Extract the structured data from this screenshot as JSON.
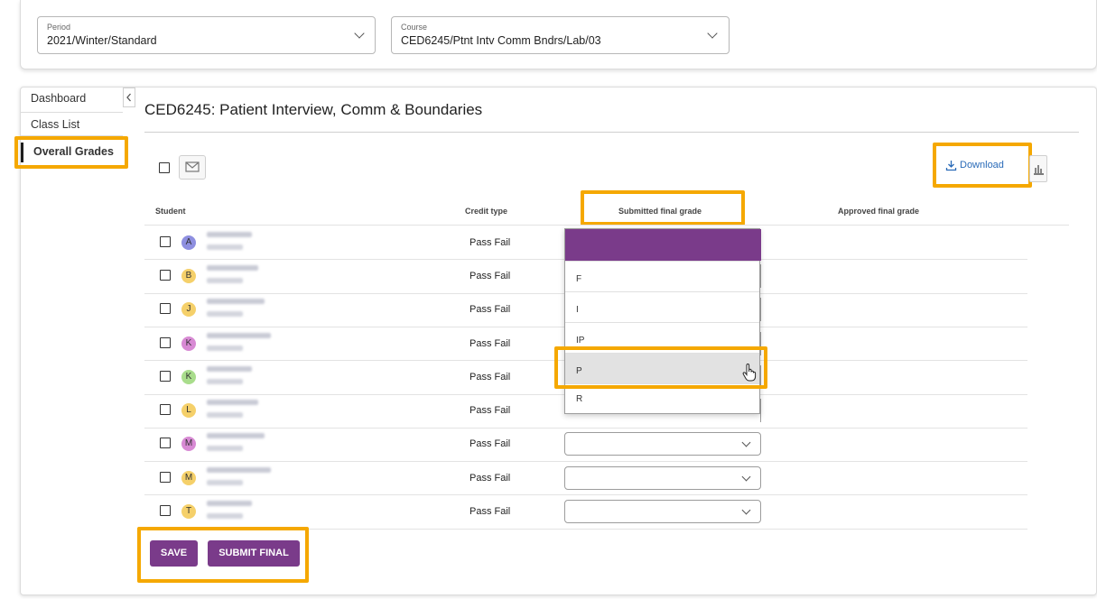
{
  "selectors": {
    "period": {
      "label": "Period",
      "value": "2021/Winter/Standard"
    },
    "course": {
      "label": "Course",
      "value": "CED6245/Ptnt Intv Comm Bndrs/Lab/03"
    }
  },
  "sidebar": {
    "items": [
      {
        "label": "Dashboard"
      },
      {
        "label": "Class List"
      },
      {
        "label": "Overall Grades",
        "active": true
      }
    ]
  },
  "page": {
    "title": "CED6245: Patient Interview, Comm & Boundaries"
  },
  "toolbar": {
    "download_label": "Download"
  },
  "table": {
    "headers": {
      "student": "Student",
      "credit_type": "Credit type",
      "submitted": "Submitted final grade",
      "approved": "Approved final grade"
    },
    "rows": [
      {
        "initial": "A",
        "avatar_color": "#8e8fe0",
        "credit_type": "Pass Fail"
      },
      {
        "initial": "B",
        "avatar_color": "#f5d06a",
        "credit_type": "Pass Fail"
      },
      {
        "initial": "J",
        "avatar_color": "#f5d06a",
        "credit_type": "Pass Fail"
      },
      {
        "initial": "K",
        "avatar_color": "#d88ad4",
        "credit_type": "Pass Fail"
      },
      {
        "initial": "K",
        "avatar_color": "#a9dd8c",
        "credit_type": "Pass Fail"
      },
      {
        "initial": "L",
        "avatar_color": "#f5d06a",
        "credit_type": "Pass Fail"
      },
      {
        "initial": "M",
        "avatar_color": "#d88ad4",
        "credit_type": "Pass Fail"
      },
      {
        "initial": "M",
        "avatar_color": "#f5d06a",
        "credit_type": "Pass Fail"
      },
      {
        "initial": "T",
        "avatar_color": "#f5d06a",
        "credit_type": "Pass Fail"
      }
    ]
  },
  "grade_dropdown": {
    "options": [
      "",
      "F",
      "I",
      "IP",
      "P",
      "R"
    ],
    "hovered": "P"
  },
  "actions": {
    "save_label": "SAVE",
    "submit_label": "SUBMIT FINAL"
  },
  "colors": {
    "brand_purple": "#7a3b8a",
    "highlight": "#f5a800",
    "link_blue": "#2a6bb8"
  }
}
